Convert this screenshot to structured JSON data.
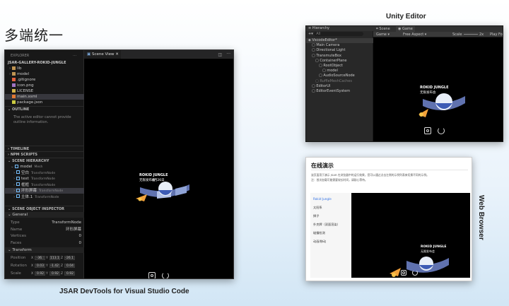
{
  "header": {
    "title": "多端统一"
  },
  "captions": {
    "vscode": "JSAR DevTools for Visual Studio Code",
    "unity": "Unity Editor",
    "web": "Web Browser"
  },
  "vscode": {
    "explorer_title": "EXPLORER",
    "project": "JSAR-GALLERY-ROKID-JUNGLE",
    "files": [
      {
        "name": "lib",
        "icon": "folder-icon"
      },
      {
        "name": "model",
        "icon": "folder-icon"
      },
      {
        "name": ".gitignore",
        "icon": "git-icon"
      },
      {
        "name": "icon.png",
        "icon": "image-icon"
      },
      {
        "name": "LICENSE",
        "icon": "license-icon"
      },
      {
        "name": "main.xsml",
        "icon": "xml-file-icon"
      },
      {
        "name": "package.json",
        "icon": "json-file-icon"
      }
    ],
    "outline_title": "OUTLINE",
    "outline_msg": "The active editor cannot provide outline information.",
    "timeline_title": "TIMELINE",
    "npm_title": "NPM SCRIPTS",
    "hierarchy_title": "SCENE HIERARCHY",
    "hierarchy": [
      {
        "name": "model",
        "type": "Mesh"
      },
      {
        "name": "空白",
        "type": "TransformNode"
      },
      {
        "name": "text",
        "type": "TransformNode"
      },
      {
        "name": "框框",
        "type": "TransformNode"
      },
      {
        "name": "环形屏幕",
        "type": "TransformNode"
      },
      {
        "name": "主体.1",
        "type": "TransformNode"
      }
    ],
    "inspector_title": "SCENE OBJECT INSPECTOR",
    "general_label": "General",
    "general_props": [
      {
        "k": "Type",
        "v": "TransformNode"
      },
      {
        "k": "Name",
        "v": "环形屏幕"
      },
      {
        "k": "Vertices",
        "v": "0"
      },
      {
        "k": "Faces",
        "v": "0"
      }
    ],
    "transform_label": "Transform",
    "transform": [
      {
        "k": "Position",
        "x": "-36.:",
        "y": "113.1",
        "z": "-26.1"
      },
      {
        "k": "Rotation",
        "x": "0.03",
        "y": "-1.42",
        "z": "0.04"
      },
      {
        "k": "Scale",
        "x": "0.92",
        "y": "0.92",
        "z": "0.92"
      }
    ],
    "tab_label": "Scene View"
  },
  "scene": {
    "brand": "ROKID JUNGLE",
    "sub": "无限发布会",
    "tag": "8月26日"
  },
  "unity": {
    "hierarchy_tab": "Hierarchy",
    "scene_tab": "Scene",
    "game_tab": "Game",
    "display": "Game",
    "aspect": "Free Aspect",
    "scale_label": "Scale",
    "scale_value": "2x",
    "play_label": "Play Fo",
    "search_placeholder": "All",
    "tree": [
      {
        "name": "VscodeEditor*",
        "depth": 0
      },
      {
        "name": "Main Camera",
        "depth": 1
      },
      {
        "name": "Directional Light",
        "depth": 1
      },
      {
        "name": "TransmuteBox",
        "depth": 1
      },
      {
        "name": "ContainerPlane",
        "depth": 2
      },
      {
        "name": "RootObject",
        "depth": 3
      },
      {
        "name": "model",
        "depth": 4
      },
      {
        "name": "AudioSourceNode",
        "depth": 3
      },
      {
        "name": "RuffleMeshCaches",
        "depth": 2
      },
      {
        "name": "EditorUI",
        "depth": 1
      },
      {
        "name": "EditorEventSystem",
        "depth": 1
      }
    ]
  },
  "web": {
    "title": "在线演示",
    "desc1": "该页面用于演示 JSAR 在浏览器中的运行效果，您可以通过点击左侧的示例列表来切换不同的示例。",
    "desc2": "注：首次加载可能需要较长时间，请耐心等待。",
    "menu": [
      "Rokid Jungle",
      "太阳系",
      "狮子",
      "扑克牌（双面渲染）",
      "碰撞检测",
      "动画/移动"
    ],
    "active_color": "#2f6fe4"
  },
  "colors": {
    "vscode_bg": "#1e1e1e",
    "unity_bg": "#282828",
    "accent": "#2f6fe4"
  }
}
